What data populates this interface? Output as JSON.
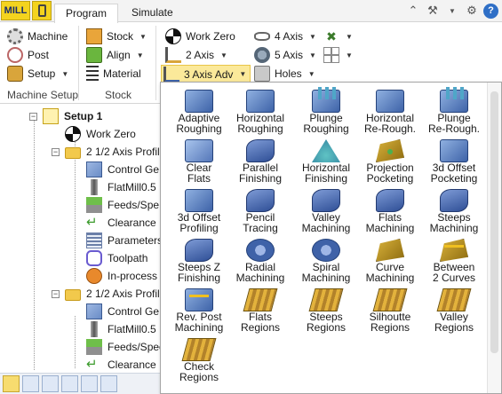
{
  "tabbar": {
    "app_label": "MILL",
    "tabs": [
      "Program",
      "Simulate"
    ]
  },
  "ribbon": {
    "machine_setup": {
      "label": "Machine Setup",
      "items": [
        "Machine",
        "Post",
        "Setup"
      ]
    },
    "stock": {
      "label": "Stock",
      "items": [
        "Stock",
        "Align",
        "Material"
      ]
    },
    "ops": {
      "work_zero": "Work Zero",
      "two_axis": "2 Axis",
      "three_axis_adv": "3 Axis Adv",
      "four_axis": "4 Axis",
      "five_axis": "5 Axis",
      "holes": "Holes"
    }
  },
  "tree": {
    "setup": "Setup 1",
    "work_zero": "Work Zero",
    "profile1": "2 1/2 Axis Profil",
    "control1": "Control Ge",
    "tool1": "FlatMill0.5",
    "feeds1": "Feeds/Spe",
    "clear1": "Clearance",
    "params1": "Parameters",
    "toolpath1": "Toolpath",
    "inprocess1": "In-process",
    "profile2": "2 1/2 Axis Profil",
    "control2": "Control Ge",
    "tool2": "FlatMill0.5",
    "feeds2": "Feeds/Spee",
    "clear2": "Clearance"
  },
  "menu": {
    "items": [
      [
        "Adaptive",
        "Roughing"
      ],
      [
        "Horizontal",
        "Roughing"
      ],
      [
        "Plunge",
        "Roughing"
      ],
      [
        "Horizontal",
        "Re-Rough."
      ],
      [
        "Plunge",
        "Re-Rough."
      ],
      [
        "Clear",
        "Flats"
      ],
      [
        "Parallel",
        "Finishing"
      ],
      [
        "Horizontal",
        "Finishing"
      ],
      [
        "Projection",
        "Pocketing"
      ],
      [
        "3d Offset",
        "Pocketing"
      ],
      [
        "3d Offset",
        "Profiling"
      ],
      [
        "Pencil",
        "Tracing"
      ],
      [
        "Valley",
        "Machining"
      ],
      [
        "Flats",
        "Machining"
      ],
      [
        "Steeps",
        "Machining"
      ],
      [
        "Steeps Z",
        "Finishing"
      ],
      [
        "Radial",
        "Machining"
      ],
      [
        "Spiral",
        "Machining"
      ],
      [
        "Curve",
        "Machining"
      ],
      [
        "Between",
        "2 Curves"
      ],
      [
        "Rev. Post",
        "Machining"
      ],
      [
        "Flats",
        "Regions"
      ],
      [
        "Steeps",
        "Regions"
      ],
      [
        "Silhoutte",
        "Regions"
      ],
      [
        "Valley",
        "Regions"
      ],
      [
        "Check",
        "Regions"
      ]
    ]
  }
}
